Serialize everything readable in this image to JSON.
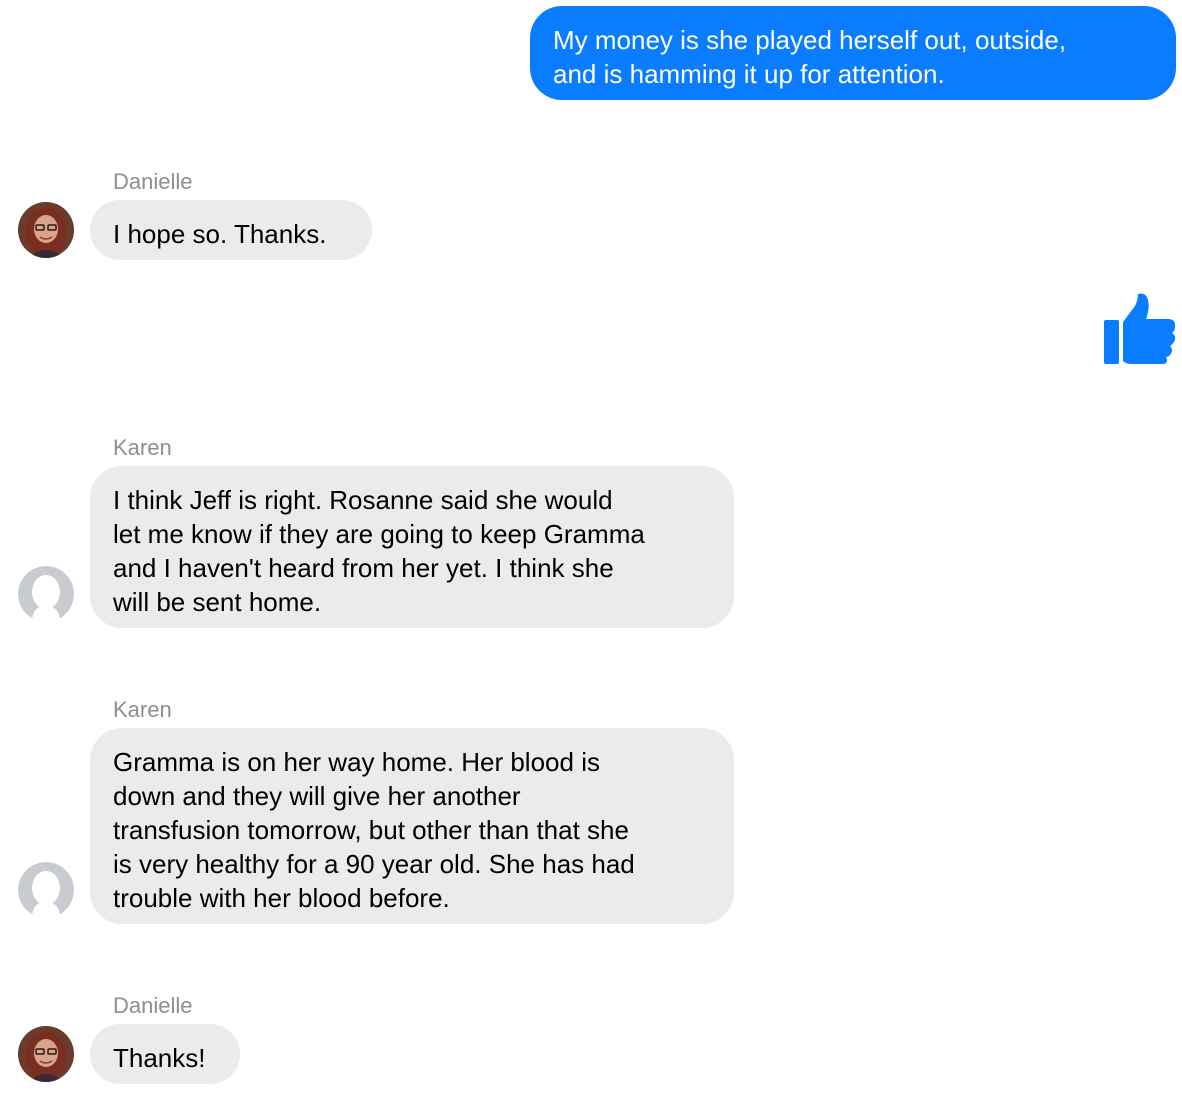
{
  "messages": [
    {
      "direction": "outgoing",
      "text": "My money is she played herself out, outside,\nand is hamming it up for attention."
    },
    {
      "direction": "incoming",
      "sender": "Danielle",
      "avatar": "photo-avatar",
      "text": "I hope so. Thanks."
    },
    {
      "direction": "outgoing",
      "reaction": "thumbs-up-icon"
    },
    {
      "direction": "incoming",
      "sender": "Karen",
      "avatar": "default-avatar-icon",
      "text": "I think Jeff is right.  Rosanne said she would\nlet me know if they are going to keep Gramma\nand I haven't heard from her yet.  I think she\nwill be sent home."
    },
    {
      "direction": "incoming",
      "sender": "Karen",
      "avatar": "default-avatar-icon",
      "text": "Gramma is on her way home.  Her blood is\ndown and they will give her another\ntransfusion tomorrow, but other than that she\nis very healthy for a 90 year old.  She has had\ntrouble with her blood before."
    },
    {
      "direction": "incoming",
      "sender": "Danielle",
      "avatar": "photo-avatar",
      "text": "Thanks!"
    }
  ],
  "colors": {
    "outgoing_bubble": "#0a7cff",
    "incoming_bubble": "#ebebeb",
    "sender_label": "#8e8e93",
    "like_icon": "#0a7cff",
    "default_avatar": "#c8cbd0"
  }
}
